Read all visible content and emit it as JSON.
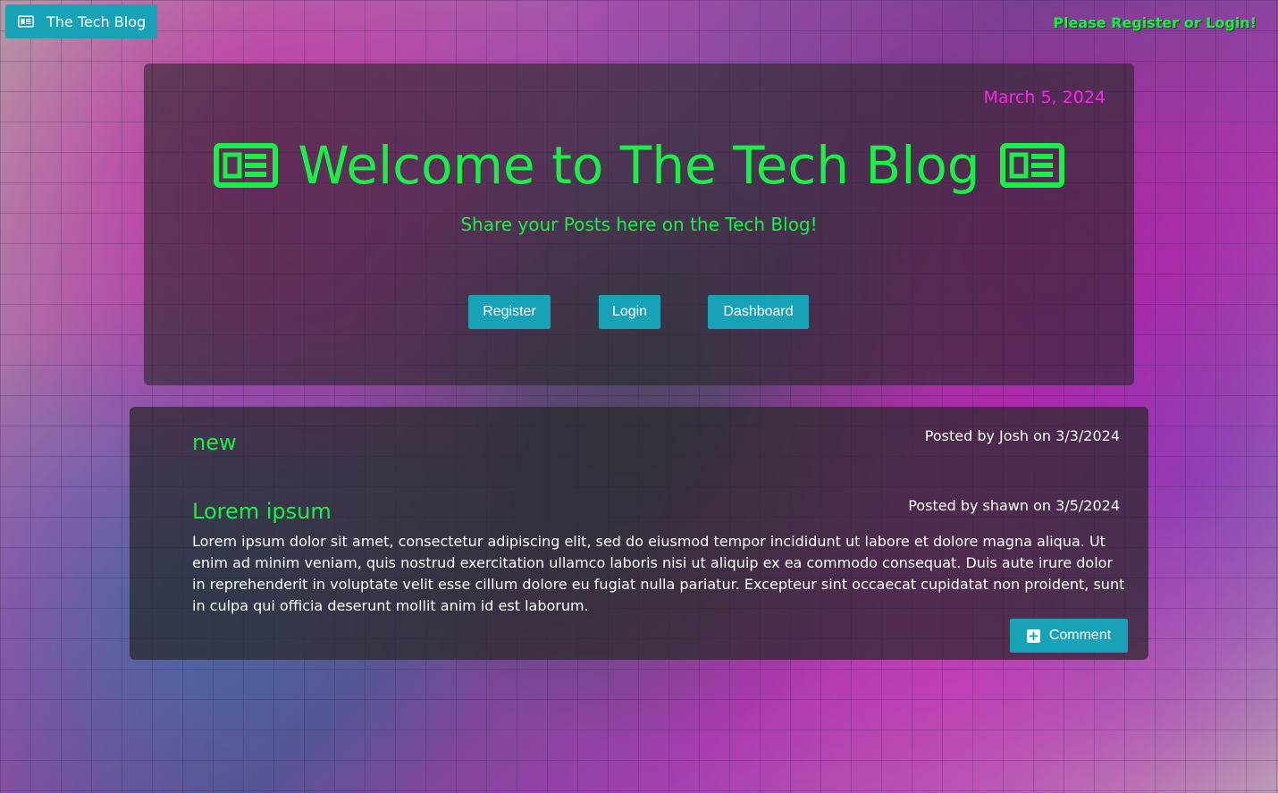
{
  "nav": {
    "brand_label": "The Tech Blog",
    "login_prompt": "Please Register or Login!"
  },
  "hero": {
    "date": "March 5, 2024",
    "title": "Welcome to The Tech Blog",
    "subtitle": "Share your Posts here on the Tech Blog!",
    "register_label": "Register",
    "login_label": "Login",
    "dashboard_label": "Dashboard"
  },
  "posts": [
    {
      "title": "new",
      "meta": "Posted by Josh on 3/3/2024",
      "body": ""
    },
    {
      "title": "Lorem ipsum",
      "meta": "Posted by shawn on 3/5/2024",
      "body": "Lorem ipsum dolor sit amet, consectetur adipiscing elit, sed do eiusmod tempor incididunt ut labore et dolore magna aliqua. Ut enim ad minim veniam, quis nostrud exercitation ullamco laboris nisi ut aliquip ex ea commodo consequat. Duis aute irure dolor in reprehenderit in voluptate velit esse cillum dolore eu fugiat nulla pariatur. Excepteur sint occaecat cupidatat non proident, sunt in culpa qui officia deserunt mollit anim id est laborum."
    }
  ],
  "comment_label": "Comment",
  "colors": {
    "accent": "#17a2b8",
    "green": "#18f048",
    "magenta": "#ff22ee"
  },
  "icons": {
    "brand": "newspaper-icon",
    "title": "newspaper-icon",
    "comment": "plus-square-icon"
  }
}
